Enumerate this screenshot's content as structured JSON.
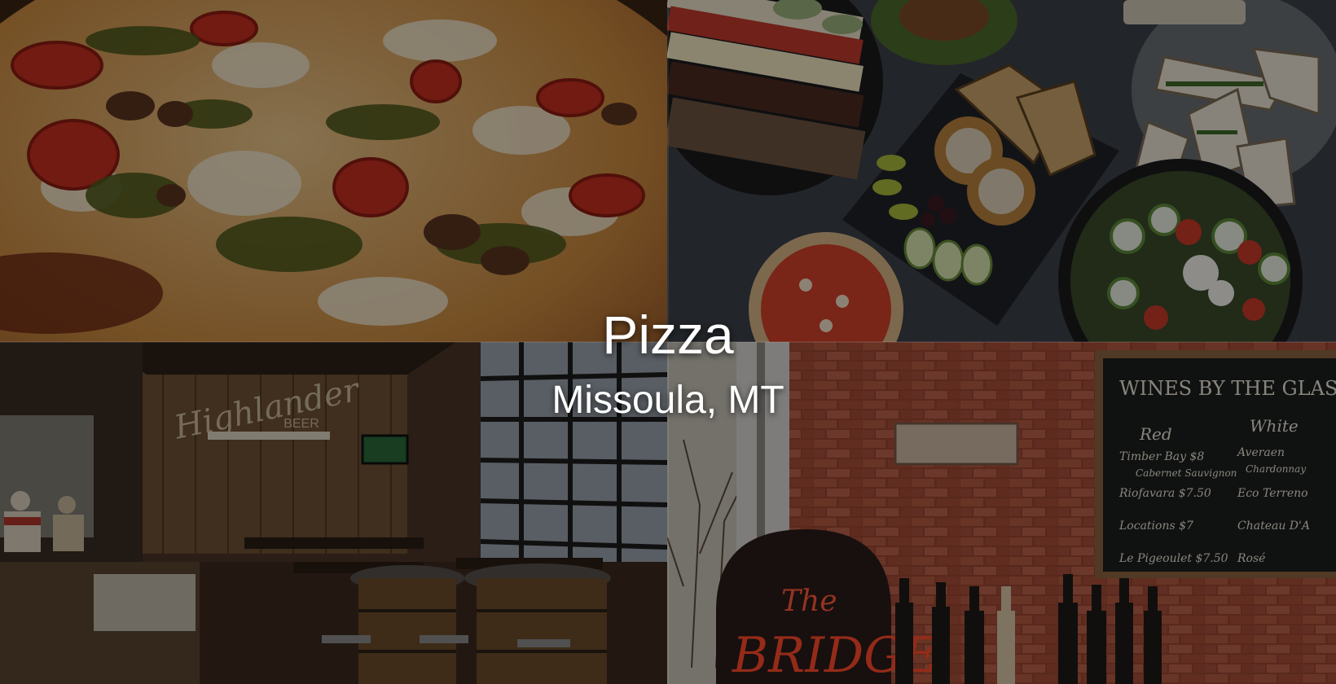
{
  "hero": {
    "title": "Pizza",
    "subtitle": "Missoula, MT"
  },
  "photos": [
    {
      "name": "pizza-closeup-photo"
    },
    {
      "name": "catering-platters-photo"
    },
    {
      "name": "restaurant-interior-photo",
      "signage": "Highlander BEER"
    },
    {
      "name": "wine-bar-chalkboard-photo",
      "signage": "The BRIDGE",
      "chalkboard": "WINES BY THE GLASS"
    }
  ],
  "colors": {
    "overlay": "#000000",
    "text": "#ffffff",
    "brick": "#8a3b2a",
    "pizza": "#b8742e"
  }
}
